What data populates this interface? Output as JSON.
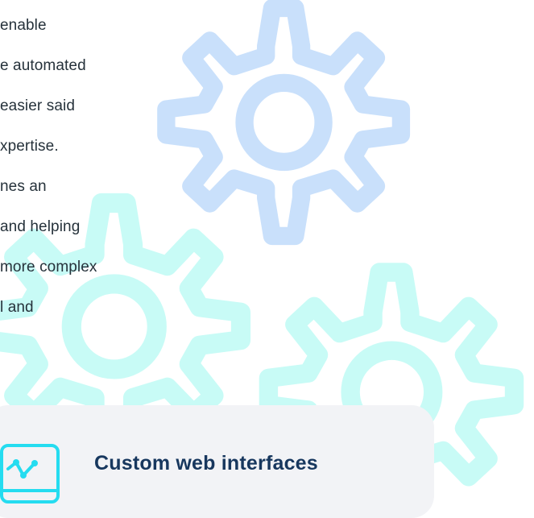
{
  "theme": {
    "text": "#26323b",
    "title": "#17375e",
    "accent_blue": "#c9e0fb",
    "accent_teal": "#c8fbf6",
    "card_bg": "#f2f3f6",
    "icon_cyan": "#25dcf0"
  },
  "article": {
    "lines": [
      "enable",
      "e automated",
      "easier said",
      "xpertise.",
      "nes an",
      " and helping",
      "more complex",
      "l and"
    ]
  },
  "graphics": {
    "gear_1_icon": "gear-icon",
    "gear_2_icon": "gear-icon",
    "gear_3_icon": "gear-icon",
    "feature_icon": "line-chart-monitor-icon"
  },
  "feature": {
    "title": "Custom web interfaces"
  }
}
